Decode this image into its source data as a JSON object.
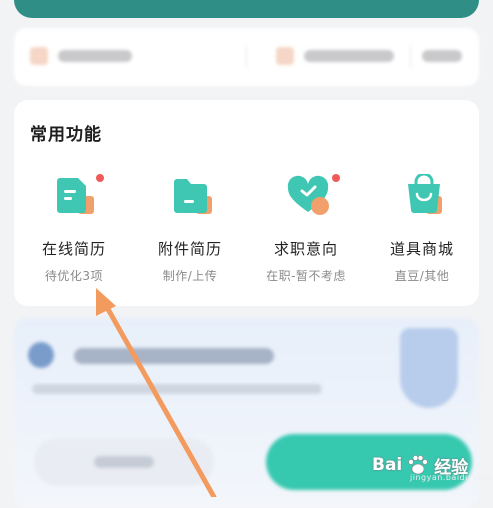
{
  "common_functions": {
    "title": "常用功能",
    "items": [
      {
        "label": "在线简历",
        "sub": "待优化3项",
        "icon": "resume-icon",
        "dot": true
      },
      {
        "label": "附件简历",
        "sub": "制作/上传",
        "icon": "folder-icon",
        "dot": false
      },
      {
        "label": "求职意向",
        "sub": "在职-暂不考虑",
        "icon": "heart-icon",
        "dot": true
      },
      {
        "label": "道具商城",
        "sub": "直豆/其他",
        "icon": "shopping-bag-icon",
        "dot": false
      }
    ]
  },
  "watermark": {
    "text": "Bai",
    "text2": "经验",
    "sub": "jingyan.baidu.com"
  },
  "colors": {
    "accent": "#3fc7b4",
    "accent_dark": "#2f8f86",
    "accent_orange": "#f2a06b",
    "dot": "#f05a5a",
    "arrow": "#f39a5f"
  }
}
